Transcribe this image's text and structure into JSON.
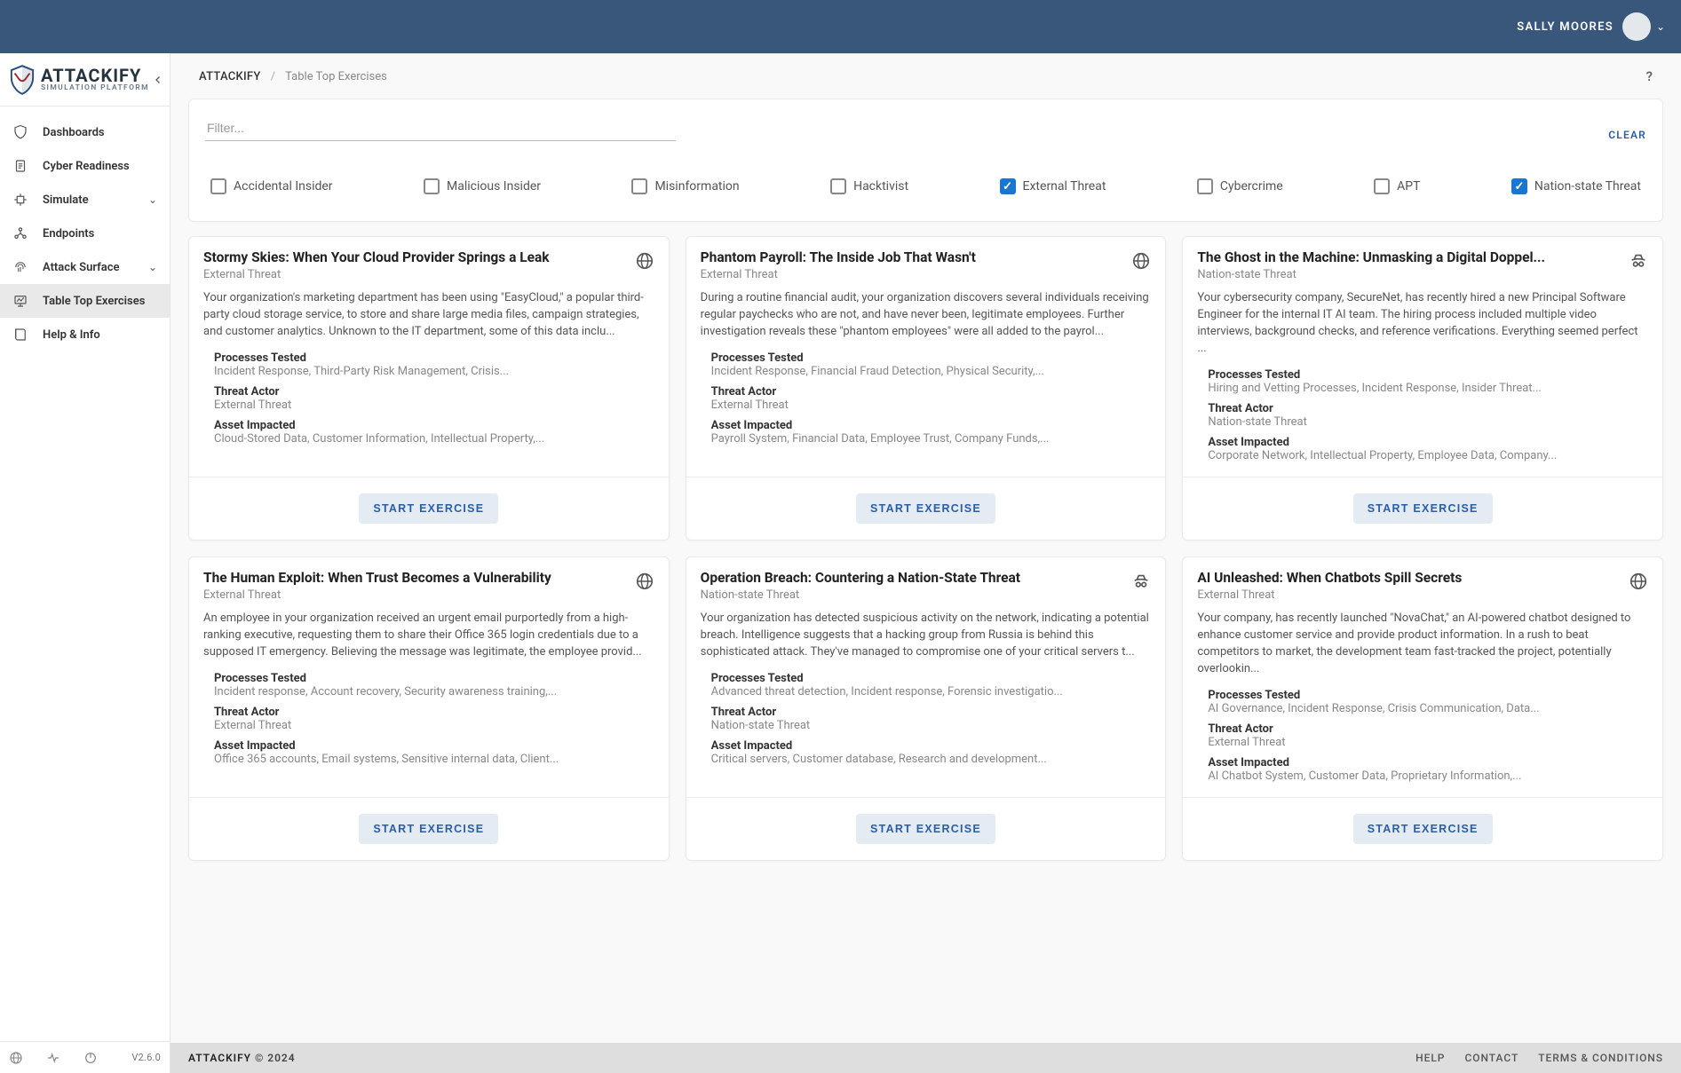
{
  "header": {
    "username": "SALLY MOORES"
  },
  "logo": {
    "title": "ATTACKIFY",
    "subtitle": "SIMULATION PLATFORM"
  },
  "sidebar": {
    "items": [
      {
        "label": "Dashboards",
        "icon": "shield-icon",
        "expandable": false,
        "active": false
      },
      {
        "label": "Cyber Readiness",
        "icon": "clipboard-icon",
        "expandable": false,
        "active": false
      },
      {
        "label": "Simulate",
        "icon": "target-icon",
        "expandable": true,
        "active": false
      },
      {
        "label": "Endpoints",
        "icon": "network-icon",
        "expandable": false,
        "active": false
      },
      {
        "label": "Attack Surface",
        "icon": "fingerprint-icon",
        "expandable": true,
        "active": false
      },
      {
        "label": "Table Top Exercises",
        "icon": "presentation-icon",
        "expandable": false,
        "active": true
      },
      {
        "label": "Help & Info",
        "icon": "book-icon",
        "expandable": false,
        "active": false
      }
    ],
    "version": "V2.6.0"
  },
  "breadcrumb": {
    "root": "ATTACKIFY",
    "current": "Table Top Exercises"
  },
  "help_icon": "?",
  "filter": {
    "placeholder": "Filter...",
    "value": "",
    "clear": "CLEAR",
    "options": [
      {
        "label": "Accidental Insider",
        "checked": false
      },
      {
        "label": "Malicious Insider",
        "checked": false
      },
      {
        "label": "Misinformation",
        "checked": false
      },
      {
        "label": "Hacktivist",
        "checked": false
      },
      {
        "label": "External Threat",
        "checked": true
      },
      {
        "label": "Cybercrime",
        "checked": false
      },
      {
        "label": "APT",
        "checked": false
      },
      {
        "label": "Nation-state Threat",
        "checked": true
      }
    ]
  },
  "labels": {
    "processes": "Processes Tested",
    "actor": "Threat Actor",
    "asset": "Asset Impacted",
    "start": "START EXERCISE"
  },
  "cards": [
    {
      "title": "Stormy Skies: When Your Cloud Provider Springs a Leak",
      "threat": "External Threat",
      "icon": "globe",
      "desc": "Your organization's marketing department has been using \"EasyCloud,\" a popular third-party cloud storage service, to store and share large media files, campaign strategies, and customer analytics. Unknown to the IT department, some of this data inclu...",
      "processes": "Incident Response, Third-Party Risk Management, Crisis...",
      "actor": "External Threat",
      "asset": "Cloud-Stored Data, Customer Information, Intellectual Property,..."
    },
    {
      "title": "Phantom Payroll: The Inside Job That Wasn't",
      "threat": "External Threat",
      "icon": "globe",
      "desc": "During a routine financial audit, your organization discovers several individuals receiving regular paychecks who are not, and have never been, legitimate employees. Further investigation reveals these \"phantom employees\" were all added to the payrol...",
      "processes": "Incident Response, Financial Fraud Detection, Physical Security,...",
      "actor": "External Threat",
      "asset": "Payroll System, Financial Data, Employee Trust, Company Funds,..."
    },
    {
      "title": "The Ghost in the Machine: Unmasking a Digital Doppel...",
      "threat": "Nation-state Threat",
      "icon": "spy",
      "desc": "Your cybersecurity company, SecureNet, has recently hired a new Principal Software Engineer for the internal IT AI team. The hiring process included multiple video interviews, background checks, and reference verifications. Everything seemed perfect ...",
      "processes": "Hiring and Vetting Processes, Incident Response, Insider Threat...",
      "actor": "Nation-state Threat",
      "asset": "Corporate Network, Intellectual Property, Employee Data, Company..."
    },
    {
      "title": "The Human Exploit: When Trust Becomes a Vulnerability",
      "threat": "External Threat",
      "icon": "globe",
      "desc": "An employee in your organization received an urgent email purportedly from a high-ranking executive, requesting them to share their Office 365 login credentials due to a supposed IT emergency. Believing the message was legitimate, the employee provid...",
      "processes": "Incident response, Account recovery, Security awareness training,...",
      "actor": "External Threat",
      "asset": "Office 365 accounts, Email systems, Sensitive internal data, Client..."
    },
    {
      "title": "Operation Breach: Countering a Nation-State Threat",
      "threat": "Nation-state Threat",
      "icon": "spy",
      "desc": "Your organization has detected suspicious activity on the network, indicating a potential breach. Intelligence suggests that a hacking group from Russia is behind this sophisticated attack. They've managed to compromise one of your critical servers t...",
      "processes": "Advanced threat detection, Incident response, Forensic investigatio...",
      "actor": "Nation-state Threat",
      "asset": "Critical servers, Customer database, Research and development..."
    },
    {
      "title": "AI Unleashed: When Chatbots Spill Secrets",
      "threat": "External Threat",
      "icon": "globe",
      "desc": "Your company, has recently launched \"NovaChat,\" an AI-powered chatbot designed to enhance customer service and provide product information. In a rush to beat competitors to market, the development team fast-tracked the project, potentially overlookin...",
      "processes": "AI Governance, Incident Response, Crisis Communication, Data...",
      "actor": "External Threat",
      "asset": "AI Chatbot System, Customer Data, Proprietary Information,..."
    }
  ],
  "footer": {
    "brand": "ATTACKIFY",
    "copy": "© 2024",
    "links": [
      "HELP",
      "CONTACT",
      "TERMS & CONDITIONS"
    ]
  }
}
